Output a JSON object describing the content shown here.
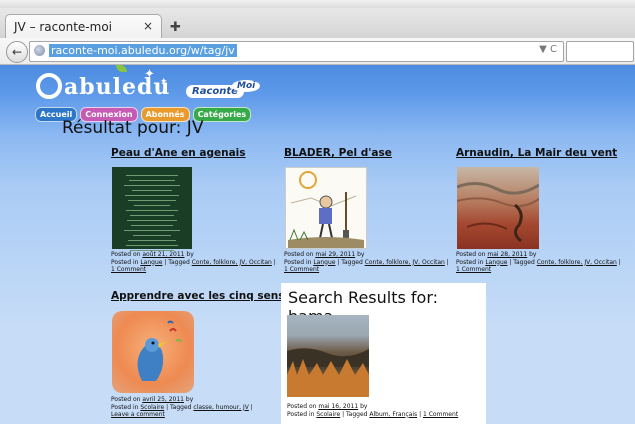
{
  "browser": {
    "tab_title": "JV – raconte-moi",
    "tab_close": "×",
    "new_tab": "✚",
    "back": "←",
    "url": "raconte-moi.abuledu.org/w/tag/jv",
    "url_icons": "▼ C"
  },
  "site": {
    "logo_text": "abuledu",
    "raconte": "Raconte",
    "moi": "Moi",
    "menu": [
      {
        "label": "Accueil",
        "color": "#2d76c8"
      },
      {
        "label": "Connexion",
        "color": "#c65bb6"
      },
      {
        "label": "Abonnés",
        "color": "#e89a2c"
      },
      {
        "label": "Catégories",
        "color": "#36a948"
      }
    ]
  },
  "heading": "Résultat pour: JV",
  "posts": [
    {
      "title": "Peau d'Ane en agenais",
      "meta1a": "Posted on ",
      "date": "août 21, 2011",
      "meta1b": " by",
      "meta2a": "Posted in ",
      "category": "Langue",
      "meta2b": " | Tagged ",
      "tags": "Conte, folklore, JV, Occitan",
      "meta2c": " |",
      "comment": "1 Comment"
    },
    {
      "title": "BLADER, Pel d'ase",
      "meta1a": "Posted on ",
      "date": "mai 29, 2011",
      "meta1b": " by",
      "meta2a": "Posted in ",
      "category": "Langue",
      "meta2b": " | Tagged ",
      "tags": "Conte, folklore, JV, Occitan",
      "meta2c": " |",
      "comment": "1 Comment"
    },
    {
      "title": "Arnaudin, La Mair deu vent",
      "meta1a": "Posted on ",
      "date": "mai 28, 2011",
      "meta1b": " by",
      "meta2a": "Posted in ",
      "category": "Langue",
      "meta2b": " | Tagged ",
      "tags": "Conte, folklore, JV, Occitan",
      "meta2c": " |",
      "comment": "1 Comment"
    },
    {
      "title": "Apprendre avec les cinq sens",
      "meta1a": "Posted on ",
      "date": "avril 25, 2011",
      "meta1b": " by",
      "meta2a": "Posted in ",
      "category": "Scolaire",
      "meta2b": " | Tagged ",
      "tags": "classe, humour, JV",
      "meta2c": " |",
      "comment": "Leave a comment"
    }
  ],
  "search_panel": {
    "title": "Search Results for: bama",
    "meta1a": "Posted on ",
    "date": "mai 16, 2011",
    "meta1b": " by",
    "meta2a": "Posted in ",
    "category": "Scolaire",
    "meta2b": " | Tagged ",
    "tags": "Album, Français",
    "meta2c": " | ",
    "comment": "1 Comment"
  }
}
